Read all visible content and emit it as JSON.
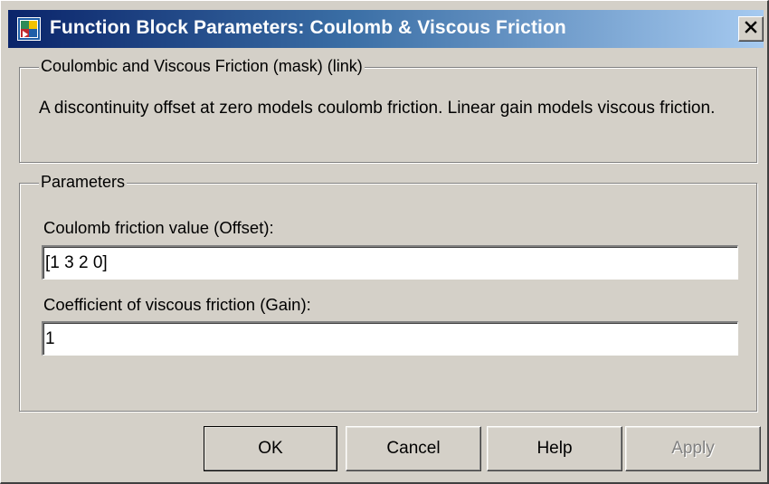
{
  "window": {
    "title": "Function Block Parameters: Coulomb & Viscous Friction",
    "icon": "simulink-block-icon",
    "close_icon": "close-x-icon"
  },
  "mask_group": {
    "legend": "Coulombic and Viscous Friction (mask) (link)",
    "description": "A discontinuity offset at zero models coulomb friction.  Linear gain models viscous friction."
  },
  "parameters_group": {
    "legend": "Parameters",
    "offset_label": "Coulomb friction value (Offset):",
    "offset_value": "[1 3 2 0]",
    "gain_label": "Coefficient of viscous friction (Gain):",
    "gain_value": "1"
  },
  "buttons": {
    "ok": "OK",
    "cancel": "Cancel",
    "help": "Help",
    "apply": "Apply"
  }
}
